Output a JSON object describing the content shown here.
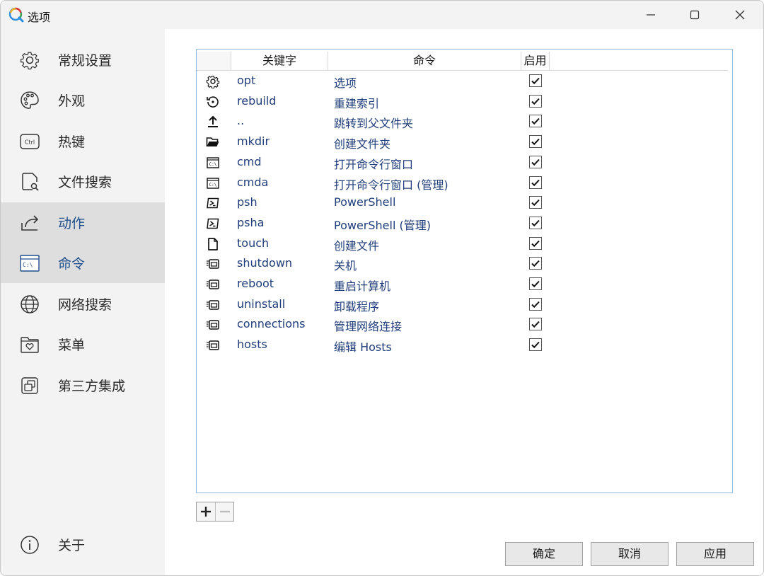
{
  "window": {
    "title": "选项"
  },
  "sidebar": {
    "items": [
      {
        "label": "常规设置",
        "icon": "gear-icon"
      },
      {
        "label": "外观",
        "icon": "palette-icon"
      },
      {
        "label": "热键",
        "icon": "ctrl-key-icon",
        "icon_text": "Ctrl"
      },
      {
        "label": "文件搜索",
        "icon": "file-search-icon"
      },
      {
        "label": "动作",
        "icon": "share-arrow-icon",
        "active": true
      },
      {
        "label": "命令",
        "icon": "console-icon",
        "icon_text": "C:\\"
      },
      {
        "label": "网络搜索",
        "icon": "globe-icon"
      },
      {
        "label": "菜单",
        "icon": "folder-heart-icon"
      },
      {
        "label": "第三方集成",
        "icon": "integration-icon"
      }
    ],
    "about": {
      "label": "关于",
      "icon": "info-icon"
    }
  },
  "table": {
    "headers": {
      "keyword": "关键字",
      "command": "命令",
      "enabled": "启用"
    },
    "rows": [
      {
        "icon": "gear-icon",
        "keyword": "opt",
        "command": "选项",
        "enabled": true
      },
      {
        "icon": "rebuild-icon",
        "keyword": "rebuild",
        "command": "重建索引",
        "enabled": true
      },
      {
        "icon": "upload-arrow-icon",
        "keyword": "..",
        "command": "跳转到父文件夹",
        "enabled": true
      },
      {
        "icon": "folder-open-icon",
        "keyword": "mkdir",
        "command": "创建文件夹",
        "enabled": true
      },
      {
        "icon": "cmd-window-icon",
        "keyword": "cmd",
        "command": "打开命令行窗口",
        "enabled": true
      },
      {
        "icon": "cmd-window-icon",
        "keyword": "cmda",
        "command": "打开命令行窗口 (管理)",
        "enabled": true
      },
      {
        "icon": "powershell-icon",
        "keyword": "psh",
        "command": "PowerShell",
        "enabled": true
      },
      {
        "icon": "powershell-icon",
        "keyword": "psha",
        "command": "PowerShell (管理)",
        "enabled": true
      },
      {
        "icon": "file-icon",
        "keyword": "touch",
        "command": "创建文件",
        "enabled": true
      },
      {
        "icon": "run-window-icon",
        "keyword": "shutdown",
        "command": "关机",
        "enabled": true
      },
      {
        "icon": "run-window-icon",
        "keyword": "reboot",
        "command": "重启计算机",
        "enabled": true
      },
      {
        "icon": "run-window-icon",
        "keyword": "uninstall",
        "command": "卸载程序",
        "enabled": true
      },
      {
        "icon": "run-window-icon",
        "keyword": "connections",
        "command": "管理网络连接",
        "enabled": true
      },
      {
        "icon": "run-window-icon",
        "keyword": "hosts",
        "command": "编辑 Hosts",
        "enabled": true
      }
    ]
  },
  "buttons": {
    "ok": "确定",
    "cancel": "取消",
    "apply": "应用"
  },
  "colors": {
    "accent": "#1f4e8c",
    "sidebar_bg": "#f3f3f3",
    "active_bg": "#dedede",
    "table_border": "#8fb8e0"
  }
}
